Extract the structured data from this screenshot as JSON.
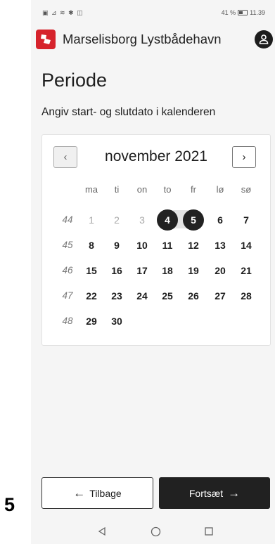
{
  "status_bar": {
    "left_icons": "▣ ⊿ ≋ ✱ ◫",
    "battery": "41 %",
    "time": "11.39"
  },
  "app": {
    "title": "Marselisborg Lystbådehavn"
  },
  "page": {
    "title": "Periode",
    "instruction": "Angiv start- og slutdato i kalenderen"
  },
  "calendar": {
    "month_label": "november 2021",
    "prev_glyph": "‹",
    "next_glyph": "›",
    "weekdays": [
      "ma",
      "ti",
      "on",
      "to",
      "fr",
      "lø",
      "sø"
    ],
    "weeks": [
      {
        "week": "44",
        "days": [
          "1",
          "2",
          "3",
          "4",
          "5",
          "6",
          "7"
        ]
      },
      {
        "week": "45",
        "days": [
          "8",
          "9",
          "10",
          "11",
          "12",
          "13",
          "14"
        ]
      },
      {
        "week": "46",
        "days": [
          "15",
          "16",
          "17",
          "18",
          "19",
          "20",
          "21"
        ]
      },
      {
        "week": "47",
        "days": [
          "22",
          "23",
          "24",
          "25",
          "26",
          "27",
          "28"
        ]
      },
      {
        "week": "48",
        "days": [
          "29",
          "30",
          "",
          "",
          "",
          "",
          ""
        ]
      }
    ],
    "disabled_days": [
      "1",
      "2",
      "3"
    ],
    "selected_range": {
      "start": "4",
      "end": "5"
    }
  },
  "footer": {
    "back_label": "Tilbage",
    "next_label": "Fortsæt",
    "back_arrow": "←",
    "next_arrow": "→"
  },
  "step_label": "5",
  "colors": {
    "brand": "#d6232c",
    "dark": "#212121",
    "background": "#f5f5f5",
    "range": "#e4e4e4"
  }
}
